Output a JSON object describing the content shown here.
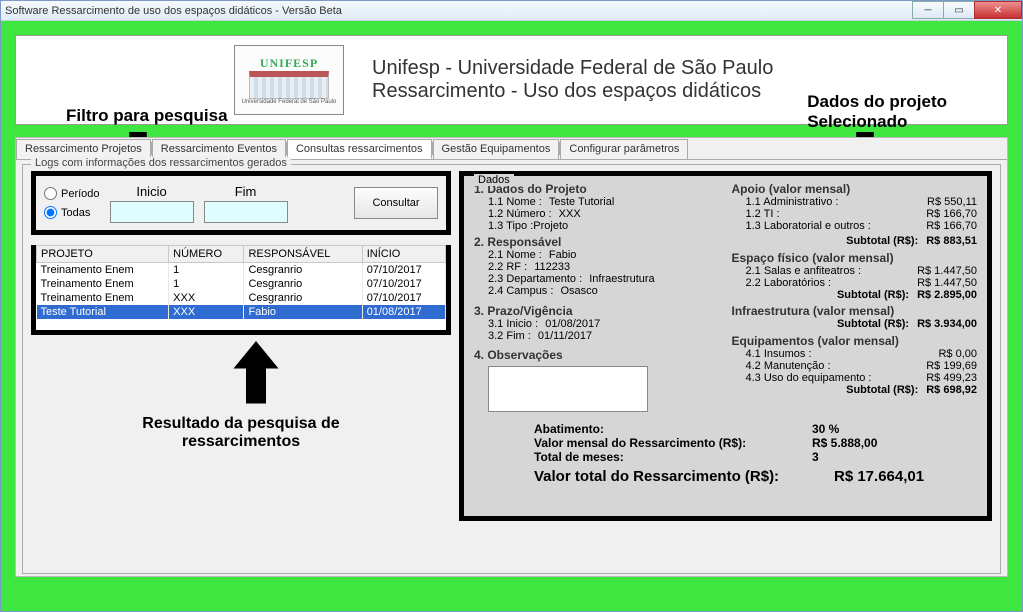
{
  "window": {
    "title": "Software Ressarcimento de uso dos espaços didáticos - Versão Beta"
  },
  "annotations": {
    "filter": "Filtro para pesquisa",
    "dados1": "Dados do projeto",
    "dados2": "Selecionado",
    "result1": "Resultado da pesquisa de",
    "result2": "ressarcimentos"
  },
  "header": {
    "logo_top": "UNIFESP",
    "logo_bottom": "Universidade Federal de São Paulo",
    "line1": "Unifesp - Universidade Federal de São Paulo",
    "line2": "Ressarcimento - Uso dos espaços didáticos"
  },
  "tabs": [
    "Ressarcimento Projetos",
    "Ressarcimento Eventos",
    "Consultas ressarcimentos",
    "Gestão Equipamentos",
    "Configurar parâmetros"
  ],
  "active_tab_index": 2,
  "logs_fieldset": "Logs com informações dos ressarcimentos gerados",
  "filter": {
    "periodo": "Período",
    "todas": "Todas",
    "inicio": "Inicio",
    "fim": "Fim",
    "consultar": "Consultar",
    "selected": "todas"
  },
  "table": {
    "headers": [
      "PROJETO",
      "NÚMERO",
      "RESPONSÁVEL",
      "INÍCIO"
    ],
    "rows": [
      {
        "projeto": "Treinamento Enem",
        "numero": "1",
        "responsavel": "Cesgranrio",
        "inicio": "07/10/2017"
      },
      {
        "projeto": "Treinamento Enem",
        "numero": "1",
        "responsavel": "Cesgranrio",
        "inicio": "07/10/2017"
      },
      {
        "projeto": "Treinamento Enem",
        "numero": "XXX",
        "responsavel": "Cesgranrio",
        "inicio": "07/10/2017"
      },
      {
        "projeto": "Teste Tutorial",
        "numero": "XXX",
        "responsavel": "Fabio",
        "inicio": "01/08/2017"
      }
    ],
    "selected_index": 3
  },
  "dados": {
    "legend": "Dados",
    "s1": "1. Dados do Projeto",
    "s1_1_l": "1.1 Nome :",
    "s1_1_v": "Teste Tutorial",
    "s1_2_l": "1.2 Número :",
    "s1_2_v": "XXX",
    "s1_3_l": "1.3 Tipo :",
    "s1_3_v": "Projeto",
    "s2": "2. Responsável",
    "s2_1_l": "2.1 Nome :",
    "s2_1_v": "Fabio",
    "s2_2_l": "2.2 RF :",
    "s2_2_v": "112233",
    "s2_3_l": "2.3 Departamento :",
    "s2_3_v": "Infraestrutura",
    "s2_4_l": "2.4 Campus :",
    "s2_4_v": "Osasco",
    "s3": "3. Prazo/Vigência",
    "s3_1_l": "3.1 Inicio :",
    "s3_1_v": "01/08/2017",
    "s3_2_l": "3.2 Fim :",
    "s3_2_v": "01/11/2017",
    "s4": "4. Observações",
    "apoio": "Apoio (valor mensal)",
    "a1_l": "1.1 Administrativo :",
    "a1_v": "R$ 550,11",
    "a2_l": "1.2 TI :",
    "a2_v": "R$ 166,70",
    "a3_l": "1.3 Laboratorial e outros :",
    "a3_v": "R$ 166,70",
    "sub1_l": "Subtotal (R$):",
    "sub1_v": "R$ 883,51",
    "espaco": "Espaço físico (valor mensal)",
    "e1_l": "2.1 Salas e anfiteatros :",
    "e1_v": "R$ 1.447,50",
    "e2_l": "2.2 Laboratórios :",
    "e2_v": "R$ 1.447,50",
    "sub2_l": "Subtotal (R$):",
    "sub2_v": "R$ 2.895,00",
    "infra": "Infraestrutura (valor mensal)",
    "sub3_l": "Subtotal (R$):",
    "sub3_v": "R$ 3.934,00",
    "equip": "Equipamentos (valor mensal)",
    "q1_l": "4.1 Insumos :",
    "q1_v": "R$ 0,00",
    "q2_l": "4.2 Manutenção :",
    "q2_v": "R$ 199,69",
    "q3_l": "4.3 Uso do equipamento :",
    "q3_v": "R$ 499,23",
    "sub4_l": "Subtotal (R$):",
    "sub4_v": "R$ 698,92",
    "abat_l": "Abatimento:",
    "abat_v": "30 %",
    "vm_l": "Valor mensal do Ressarcimento (R$):",
    "vm_v": "R$ 5.888,00",
    "tm_l": "Total de meses:",
    "tm_v": "3",
    "vt_l": "Valor total do Ressarcimento (R$):",
    "vt_v": "R$ 17.664,01"
  }
}
